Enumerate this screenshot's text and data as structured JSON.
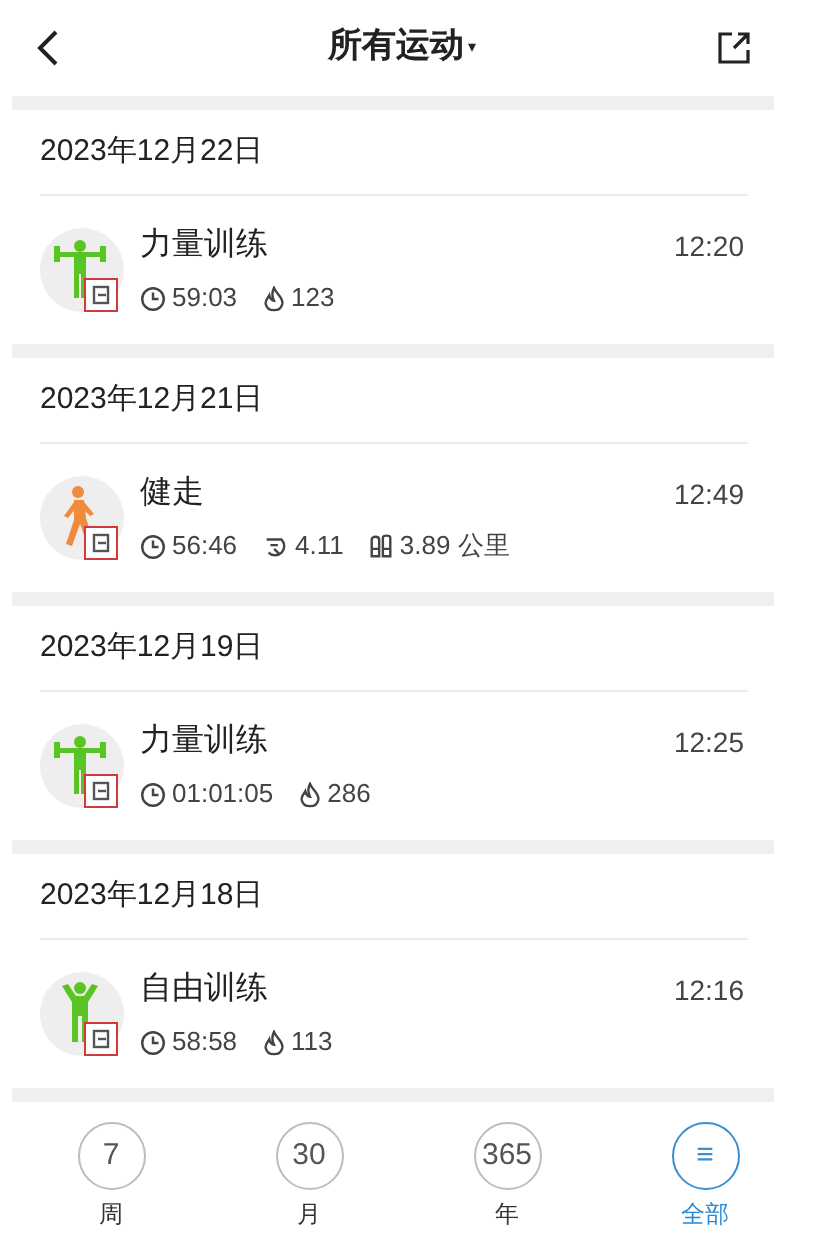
{
  "header": {
    "title": "所有运动",
    "title_caret": "▾"
  },
  "days": [
    {
      "date": "2023年12月22日",
      "workouts": [
        {
          "kind": "strength",
          "name": "力量训练",
          "time": "12:20",
          "stats": [
            {
              "kind": "duration",
              "value": "59:03"
            },
            {
              "kind": "calories",
              "value": "123"
            }
          ]
        }
      ]
    },
    {
      "date": "2023年12月21日",
      "workouts": [
        {
          "kind": "walk",
          "name": "健走",
          "time": "12:49",
          "stats": [
            {
              "kind": "duration",
              "value": "56:46"
            },
            {
              "kind": "pace",
              "value": "4.11"
            },
            {
              "kind": "distance",
              "value": "3.89 公里"
            }
          ]
        }
      ]
    },
    {
      "date": "2023年12月19日",
      "workouts": [
        {
          "kind": "strength",
          "name": "力量训练",
          "time": "12:25",
          "stats": [
            {
              "kind": "duration",
              "value": "01:01:05"
            },
            {
              "kind": "calories",
              "value": "286"
            }
          ]
        }
      ]
    },
    {
      "date": "2023年12月18日",
      "workouts": [
        {
          "kind": "free",
          "name": "自由训练",
          "time": "12:16",
          "stats": [
            {
              "kind": "duration",
              "value": "58:58"
            },
            {
              "kind": "calories",
              "value": "113"
            }
          ]
        }
      ]
    }
  ],
  "tabs": [
    {
      "symbol": "7",
      "label": "周",
      "selected": false
    },
    {
      "symbol": "30",
      "label": "月",
      "selected": false
    },
    {
      "symbol": "365",
      "label": "年",
      "selected": false
    },
    {
      "symbol": "≡",
      "label": "全部",
      "selected": true
    }
  ]
}
